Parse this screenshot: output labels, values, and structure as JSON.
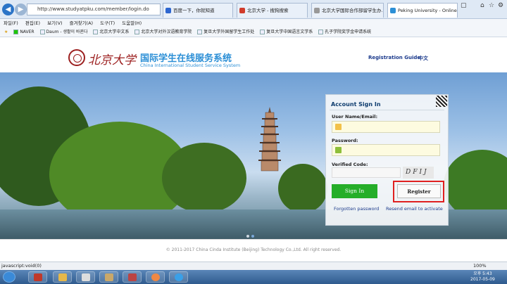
{
  "browser": {
    "url": "http://www.studyatpku.com/member/login.do",
    "tabs": [
      {
        "label": "百度一下，你就知道",
        "active": false
      },
      {
        "label": "北京大学 - 搜狗搜索",
        "active": false
      },
      {
        "label": "北京大学国际合作部留学生办...",
        "active": false
      },
      {
        "label": "Peking University - Online ...",
        "active": true
      }
    ],
    "menu": [
      "파일(F)",
      "편집(E)",
      "보기(V)",
      "즐겨찾기(A)",
      "도구(T)",
      "도움말(H)"
    ],
    "favorites": [
      "NAVER",
      "Daum - 생활이 바뀐다",
      "北京大学中文系",
      "北京大学对外汉语教育学院",
      "复旦大学外国留学生工作处",
      "复旦大学中国语言文学系",
      "孔子学院奖学金申请系统"
    ],
    "status": "javascript:void(0)",
    "zoom": "100%"
  },
  "header": {
    "logo_cn": "北京大学",
    "system_name": "国际学生在线服务系统",
    "system_name_en": "China International Student Service System",
    "registration_guide": "Registration Guide",
    "language": "中文"
  },
  "login": {
    "title": "Account Sign In",
    "username_label": "User Name/Email:",
    "password_label": "Password:",
    "verified_label": "Verified Code:",
    "captcha_text": "DFIJ",
    "signin_label": "Sign In",
    "register_label": "Register",
    "forgot_label": "Forgotten password",
    "resend_label": "Resend email to activate"
  },
  "footer": {
    "copyright": "© 2011-2017 China Cinda Institute (Beijing) Technology Co.,Ltd. All right reserved."
  },
  "taskbar": {
    "time_label": "오후 5:43",
    "date": "2017-05-09"
  },
  "colors": {
    "brand_red": "#9c1f1f",
    "brand_blue": "#2c8fd6",
    "signin_green": "#25ae29",
    "highlight_red": "#e02020"
  }
}
